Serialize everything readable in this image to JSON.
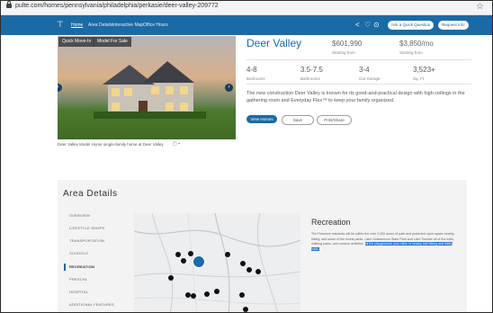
{
  "browser": {
    "url": "pulte.com/homes/pennsylvania/philadelphia/perkasie/deer-valley-209772"
  },
  "nav": {
    "items": [
      "Home",
      "Area Details",
      "Interactive Map",
      "Office Hours"
    ],
    "cta1": "Ask a Quick Question",
    "cta2": "Request Info"
  },
  "hero": {
    "tab1": "Quick Move-In",
    "tab2": "Model For Sale",
    "caption": "Deer Valley Model Home single-family home at Deer Valley"
  },
  "community": {
    "name": "Deer Valley",
    "price": "$601,990",
    "price_label": "Starting from",
    "price2": "$3,850/mo",
    "price2_label": "Starting from",
    "stats": [
      {
        "value": "4-8",
        "label": "Bedrooms"
      },
      {
        "value": "3.5-7.5",
        "label": "Bathrooms"
      },
      {
        "value": "3-4",
        "label": "Car Garage"
      },
      {
        "value": "3,523+",
        "label": "Sq. Ft."
      }
    ],
    "description": "The new construction Deer Valley is known for its good-and-practical design with high ceilings in the gathering room and Everyday Flex™ to keep your family organized.",
    "buttons": [
      "View Homes",
      "Save",
      "Print/Share"
    ]
  },
  "area": {
    "title": "Area Details",
    "sidebar": [
      "OVERVIEW",
      "LIFESTYLE SHOPS",
      "TRANSPORTATION",
      "SCHOOLS",
      "RECREATION",
      "PRESCHL",
      "HOSPITAL",
      "ADDITIONAL FEATURES"
    ],
    "selected_index": 4,
    "recreation_title": "Recreation",
    "recreation_text": "The Preserve residents will be within the over 2,000 acres of park and protected open space nearby, hiking, and some of the nicest parks. Lake Nockamixon State Park and Lake Towhee all of the trails, walking parks, and outdoor activities.",
    "recreation_highlight": "all the playgrounds plus miles of nearby trail biking and hiking trails."
  }
}
